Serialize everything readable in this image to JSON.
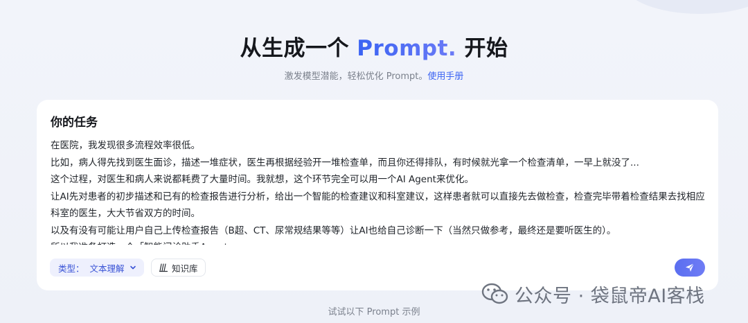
{
  "hero": {
    "title_main_left": "从生成一个 ",
    "title_accent": "Prompt.",
    "title_main_right": " 开始",
    "subtitle": "激发模型潜能，轻松优化 Prompt。",
    "subtitle_link": "使用手册"
  },
  "task_card": {
    "title": "你的任务",
    "lines": [
      "在医院，我发现很多流程效率很低。",
      "比如，病人得先找到医生面诊，描述一堆症状，医生再根据经验开一堆检查单，而且你还得排队，有时候就光拿一个检查清单，一早上就没了...",
      "这个过程，对医生和病人来说都耗费了大量时间。我就想，这个环节完全可以用一个AI Agent来优化。",
      "让AI先对患者的初步描述和已有的检查报告进行分析，给出一个智能的检查建议和科室建议，这样患者就可以直接先去做检查，检查完毕带着检查结果去找相应科室的医生，大大节省双方的时间。",
      "以及有没有可能让用户自己上传检查报告（B超、CT、尿常规结果等等）让AI也给自己诊断一下（当然只做参考，最终还是要听医生的）。",
      "所以我准备打造一个「智能问诊助手Agent」"
    ],
    "type_label": "类型：",
    "type_value": "文本理解",
    "knowledge_label": "知识库",
    "icons": {
      "type_chevron": "chevron-down-icon",
      "knowledge": "book-icon",
      "send": "send-icon"
    }
  },
  "watermark": {
    "text": "公众号 · 袋鼠帝AI客栈",
    "icon": "wechat-icon"
  },
  "footer": {
    "examples_label": "试试以下 Prompt 示例"
  },
  "colors": {
    "accent": "#3a63f3",
    "send_button": "#5f72f2",
    "chip_bg": "#eef0fd"
  }
}
